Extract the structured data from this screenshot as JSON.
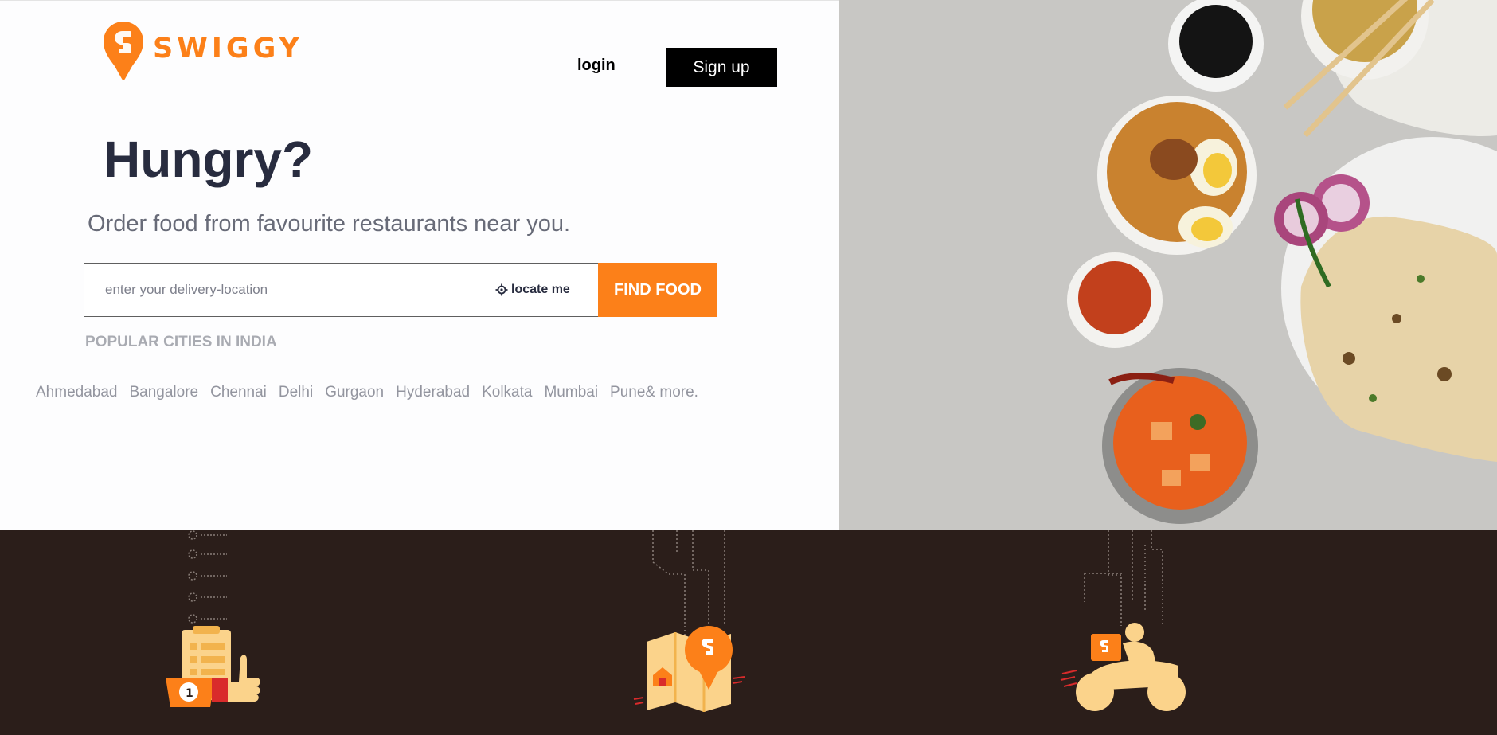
{
  "brand": {
    "name": "SWIGGY",
    "color": "#fc8019",
    "logo_icon": "swiggy-pin-logo"
  },
  "header": {
    "login_label": "login",
    "signup_label": "Sign up"
  },
  "hero": {
    "headline": "Hungry?",
    "subline": "Order food from favourite restaurants near you."
  },
  "search": {
    "placeholder": "enter your delivery-location",
    "value": "",
    "locate_label": "locate me",
    "locate_icon": "crosshair-icon",
    "find_label": "FIND FOOD"
  },
  "popular": {
    "heading": "POPULAR CITIES IN INDIA",
    "cities": [
      "Ahmedabad",
      "Bangalore",
      "Chennai",
      "Delhi",
      "Gurgaon",
      "Hyderabad",
      "Kolkata",
      "Mumbai",
      "Pune& more."
    ]
  },
  "features": {
    "icons": [
      "order-checklist-thumbs-up-icon",
      "map-location-pin-icon",
      "delivery-scooter-icon"
    ]
  },
  "colors": {
    "accent": "#fc8019",
    "headline": "#282c3f",
    "footer_bg": "#2b1e1a"
  }
}
